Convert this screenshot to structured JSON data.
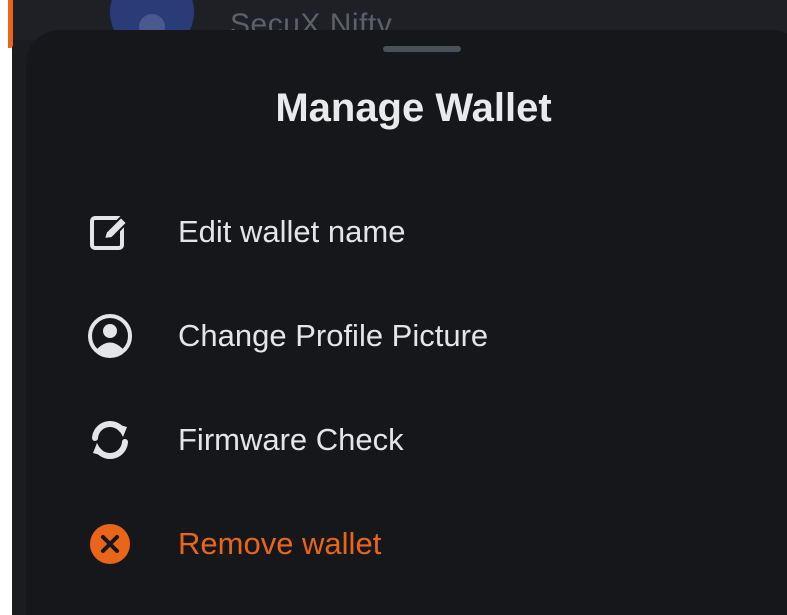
{
  "background": {
    "wallet_name": "SecuX Nifty"
  },
  "sheet": {
    "title": "Manage Wallet",
    "items": [
      {
        "label": "Edit wallet name",
        "icon": "edit-icon"
      },
      {
        "label": "Change Profile Picture",
        "icon": "profile-icon"
      },
      {
        "label": "Firmware Check",
        "icon": "refresh-icon"
      },
      {
        "label": "Remove wallet",
        "icon": "remove-icon",
        "color": "#e8651a"
      }
    ]
  },
  "colors": {
    "accent": "#e8651a",
    "sheet_background": "#15171b",
    "text": "#e4e5e8"
  }
}
